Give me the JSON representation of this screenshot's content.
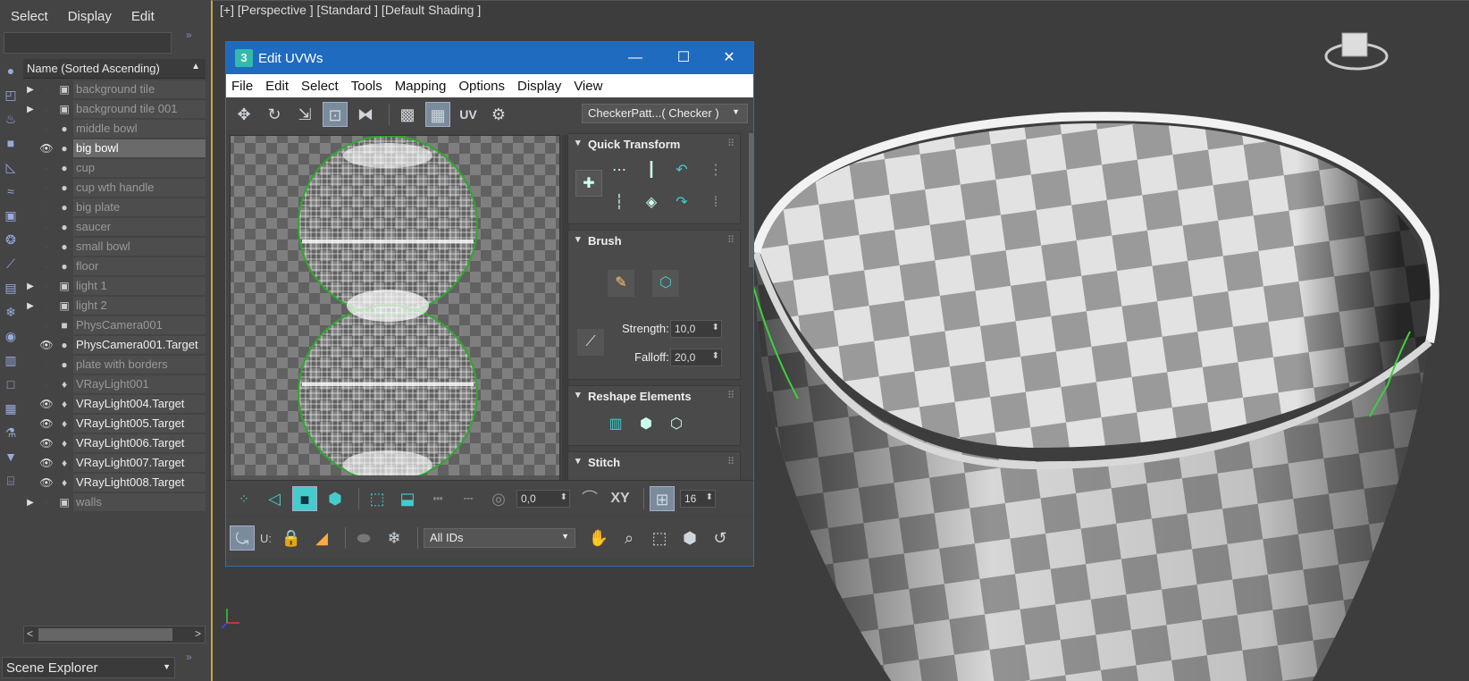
{
  "explorer": {
    "menu": [
      "Select",
      "Display",
      "Edit"
    ],
    "column_header": "Name (Sorted Ascending)",
    "items": [
      {
        "name": "background tile",
        "expand": true,
        "visible": false,
        "icon": "group-icon"
      },
      {
        "name": "background tile 001",
        "expand": true,
        "visible": false,
        "icon": "group-icon"
      },
      {
        "name": "middle bowl",
        "expand": false,
        "visible": false,
        "icon": "object-icon"
      },
      {
        "name": "big bowl",
        "expand": false,
        "visible": true,
        "icon": "object-icon",
        "selected": true
      },
      {
        "name": "cup",
        "expand": false,
        "visible": false,
        "icon": "object-icon"
      },
      {
        "name": "cup wth handle",
        "expand": false,
        "visible": false,
        "icon": "object-icon"
      },
      {
        "name": "big plate",
        "expand": false,
        "visible": false,
        "icon": "object-icon"
      },
      {
        "name": "saucer",
        "expand": false,
        "visible": false,
        "icon": "object-icon"
      },
      {
        "name": "small bowl",
        "expand": false,
        "visible": false,
        "icon": "object-icon"
      },
      {
        "name": "floor",
        "expand": false,
        "visible": false,
        "icon": "object-icon"
      },
      {
        "name": "light 1",
        "expand": true,
        "visible": false,
        "icon": "group-icon"
      },
      {
        "name": "light 2",
        "expand": true,
        "visible": false,
        "icon": "group-icon"
      },
      {
        "name": "PhysCamera001",
        "expand": false,
        "visible": false,
        "icon": "camera-icon"
      },
      {
        "name": "PhysCamera001.Target",
        "expand": false,
        "visible": true,
        "icon": "object-icon"
      },
      {
        "name": "plate with borders",
        "expand": false,
        "visible": false,
        "icon": "object-icon"
      },
      {
        "name": "VRayLight001",
        "expand": false,
        "visible": false,
        "icon": "light-icon"
      },
      {
        "name": "VRayLight004.Target",
        "expand": false,
        "visible": true,
        "icon": "light-icon"
      },
      {
        "name": "VRayLight005.Target",
        "expand": false,
        "visible": true,
        "icon": "light-icon"
      },
      {
        "name": "VRayLight006.Target",
        "expand": false,
        "visible": true,
        "icon": "light-icon"
      },
      {
        "name": "VRayLight007.Target",
        "expand": false,
        "visible": true,
        "icon": "light-icon"
      },
      {
        "name": "VRayLight008.Target",
        "expand": false,
        "visible": true,
        "icon": "light-icon"
      },
      {
        "name": "walls",
        "expand": true,
        "visible": false,
        "icon": "group-icon"
      }
    ],
    "footer_dropdown": "Scene Explorer"
  },
  "viewport": {
    "label": "[+] [Perspective ] [Standard ] [Default Shading ]"
  },
  "uvw": {
    "title": "Edit UVWs",
    "menu": [
      "File",
      "Edit",
      "Select",
      "Tools",
      "Mapping",
      "Options",
      "Display",
      "View"
    ],
    "checker_dropdown": "CheckerPatt...( Checker )",
    "uv_label": "UV",
    "rollouts": {
      "quick_transform": "Quick Transform",
      "brush": "Brush",
      "reshape": "Reshape Elements",
      "stitch": "Stitch"
    },
    "strength_label": "Strength:",
    "strength_value": "10,0",
    "falloff_label": "Falloff:",
    "falloff_value": "20,0",
    "bottom_spin": "0,0",
    "xy_label": "XY",
    "grid_value": "16",
    "u_label": "U:",
    "ids_dropdown": "All IDs"
  },
  "colors": {
    "accent": "#1e6bbf",
    "selection_green": "#3cd23c",
    "viewport_border": "#c7a64a"
  }
}
